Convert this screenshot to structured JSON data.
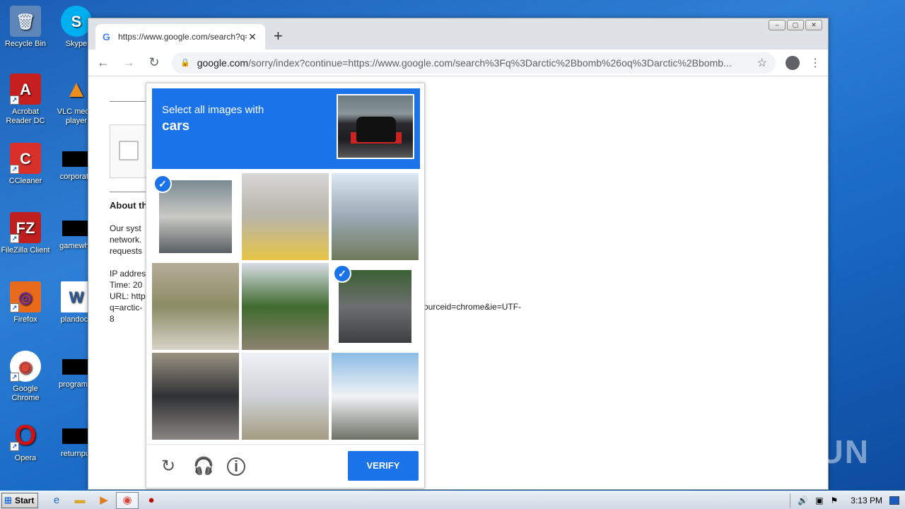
{
  "desktop": {
    "icons_left": [
      {
        "label": "Recycle Bin",
        "icon": "recycle-bin-icon"
      },
      {
        "label": "Acrobat Reader DC",
        "icon": "acrobat-icon"
      },
      {
        "label": "CCleaner",
        "icon": "ccleaner-icon"
      },
      {
        "label": "FileZilla Client",
        "icon": "filezilla-icon"
      },
      {
        "label": "Firefox",
        "icon": "firefox-icon"
      },
      {
        "label": "Google Chrome",
        "icon": "chrome-icon"
      },
      {
        "label": "Opera",
        "icon": "opera-icon"
      }
    ],
    "icons_right": [
      {
        "label": "Skype",
        "icon": "skype-icon"
      },
      {
        "label": "VLC media player",
        "icon": "vlc-icon"
      },
      {
        "label": "corporate",
        "icon": "file-icon"
      },
      {
        "label": "gamewha",
        "icon": "file-icon"
      },
      {
        "label": "plandocu",
        "icon": "word-icon"
      },
      {
        "label": "programm",
        "icon": "file-icon"
      },
      {
        "label": "returnput",
        "icon": "file-icon"
      }
    ],
    "watermark": "ANY RUN"
  },
  "browser": {
    "tab_title": "https://www.google.com/search?q=",
    "url_host": "google.com",
    "url_path": "/sorry/index?continue=https://www.google.com/search%3Fq%3Darctic%2Bbomb%26oq%3Darctic%2Bbomb...",
    "window_buttons": [
      "–",
      "▢",
      "✕"
    ]
  },
  "page": {
    "about_heading": "About th",
    "para1": "Our syst\nnetwork.\nrequests",
    "para2": "IP addres\nTime: 20\nURL: http\nq=arctic-\n8",
    "url_tail": "ourceid=chrome&ie=UTF-"
  },
  "captcha": {
    "instruction": "Select all images with",
    "target": "cars",
    "tiles": [
      {
        "selected": true,
        "colors": [
          "#7a8a92",
          "#c9c9c4",
          "#595f62"
        ]
      },
      {
        "selected": false,
        "colors": [
          "#d6d6d6",
          "#b8b4a8",
          "#e7c546"
        ]
      },
      {
        "selected": false,
        "colors": [
          "#dce8f4",
          "#9aa9b5",
          "#6f7a5b"
        ]
      },
      {
        "selected": false,
        "colors": [
          "#b6ab98",
          "#8a8c64",
          "#d8d3c8"
        ]
      },
      {
        "selected": false,
        "colors": [
          "#d9dee6",
          "#3f6b2e",
          "#8e8270"
        ]
      },
      {
        "selected": true,
        "colors": [
          "#3b5f33",
          "#6d6f70",
          "#3d3f41"
        ]
      },
      {
        "selected": false,
        "colors": [
          "#9a9384",
          "#2f3134",
          "#8a8581"
        ]
      },
      {
        "selected": false,
        "colors": [
          "#eef2f6",
          "#cfd3d8",
          "#a49b82"
        ]
      },
      {
        "selected": false,
        "colors": [
          "#8bbbe6",
          "#f0f3f5",
          "#6d7066"
        ]
      }
    ],
    "verify_label": "VERIFY"
  },
  "taskbar": {
    "start_label": "Start",
    "clock": "3:13 PM"
  }
}
